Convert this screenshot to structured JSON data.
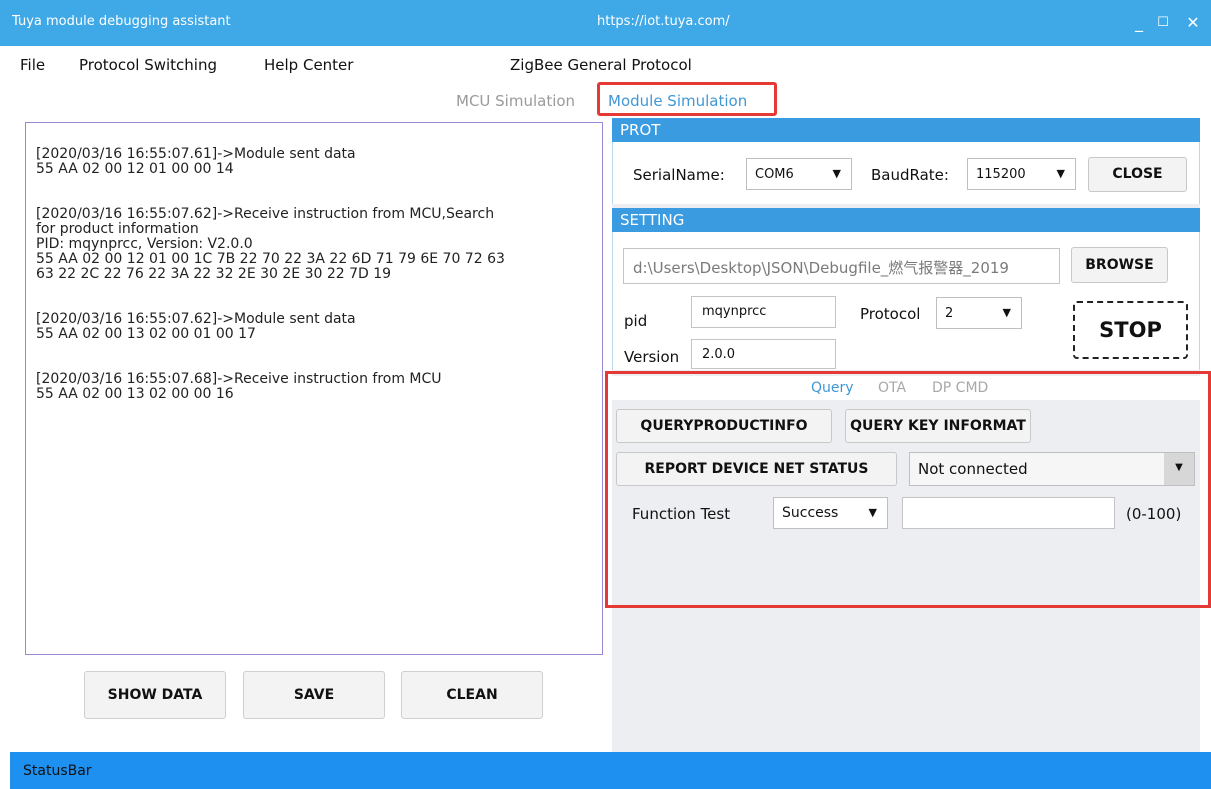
{
  "window": {
    "title": "Tuya module debugging assistant",
    "url": "https://iot.tuya.com/",
    "controls": {
      "minimize": "_",
      "maximize": "☐",
      "close": "✕"
    }
  },
  "menu": {
    "file": "File",
    "protocol_switching": "Protocol Switching",
    "help_center": "Help Center",
    "protocol_title": "ZigBee General Protocol"
  },
  "sim_tabs": {
    "mcu": "MCU Simulation",
    "module": "Module Simulation"
  },
  "log": [
    {
      "line": "[2020/03/16 16:55:07.61]->Module sent data\n55 AA 02 00 12 01 00 00 14"
    },
    {
      "line": "[2020/03/16 16:55:07.62]->Receive instruction from MCU,Search\nfor product information\nPID: mqynprcc, Version: V2.0.0\n55 AA 02 00 12 01 00 1C 7B 22 70 22 3A 22 6D 71 79 6E 70 72 63\n63 22 2C 22 76 22 3A 22 32 2E 30 2E 30 22 7D 19"
    },
    {
      "line": "[2020/03/16 16:55:07.62]->Module sent data\n55 AA 02 00 13 02 00 01 00 17"
    },
    {
      "line": "[2020/03/16 16:55:07.68]->Receive instruction from MCU\n55 AA 02 00 13 02 00 00 16"
    }
  ],
  "bottom_buttons": {
    "show_data": "SHOW DATA",
    "save": "SAVE",
    "clean": "CLEAN"
  },
  "prot": {
    "header": "PROT",
    "serial_label": "SerialName:",
    "serial_value": "COM6",
    "baud_label": "BaudRate:",
    "baud_value": "115200",
    "close_button": "CLOSE"
  },
  "setting": {
    "header": "SETTING",
    "path": "d:\\Users\\Desktop\\JSON\\Debugfile_燃气报警器_2019",
    "browse_button": "BROWSE",
    "pid_label": "pid",
    "pid_value": "mqynprcc",
    "protocol_label": "Protocol",
    "protocol_value": "2",
    "version_label": "Version",
    "version_value": "2.0.0",
    "stop_button": "STOP"
  },
  "query": {
    "tabs": {
      "query": "Query",
      "ota": "OTA",
      "dp_cmd": "DP CMD"
    },
    "query_product_info": "QUERYPRODUCTINFO",
    "query_key_info": "QUERY KEY INFORMAT",
    "report_net_status": "REPORT DEVICE NET STATUS",
    "net_status_value": "Not connected",
    "function_test_label": "Function Test",
    "function_test_value": "Success",
    "function_test_input": "",
    "range_label": "(0-100)"
  },
  "statusbar": {
    "text": "StatusBar"
  }
}
